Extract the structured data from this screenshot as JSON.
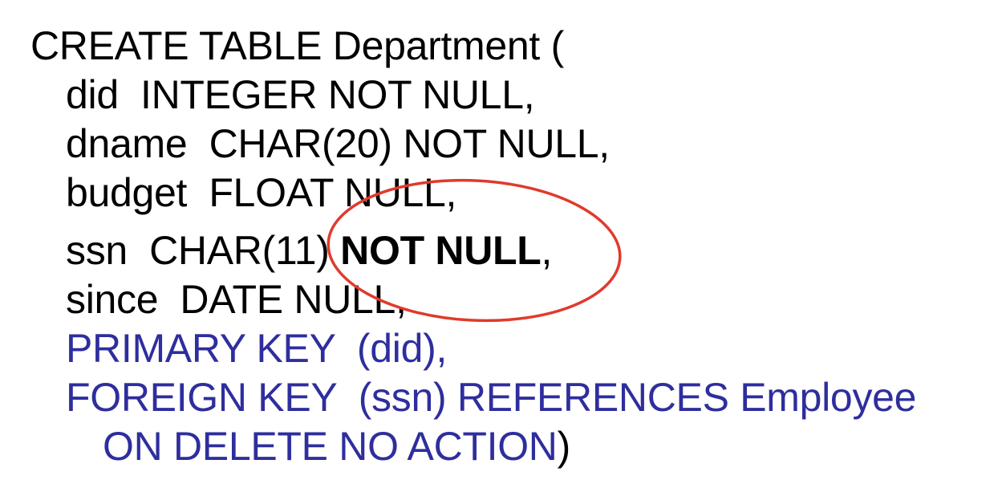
{
  "sql": {
    "line1": "CREATE TABLE Department (",
    "line2": "did  INTEGER NOT NULL,",
    "line3": "dname  CHAR(20) NOT NULL,",
    "line4": "budget  FLOAT NULL,",
    "line5_prefix": "ssn  CHAR(11) ",
    "line5_highlight": "NOT NULL",
    "line5_suffix": ",",
    "line6": "since  DATE NULL,",
    "line7": "PRIMARY KEY  (did),",
    "line8": "FOREIGN KEY  (ssn) REFERENCES Employee",
    "line9_text": "ON DELETE NO ACTION",
    "line9_close": ")"
  },
  "colors": {
    "text": "#000000",
    "constraint": "#2e2e9e",
    "annotation": "#e03a2c"
  }
}
